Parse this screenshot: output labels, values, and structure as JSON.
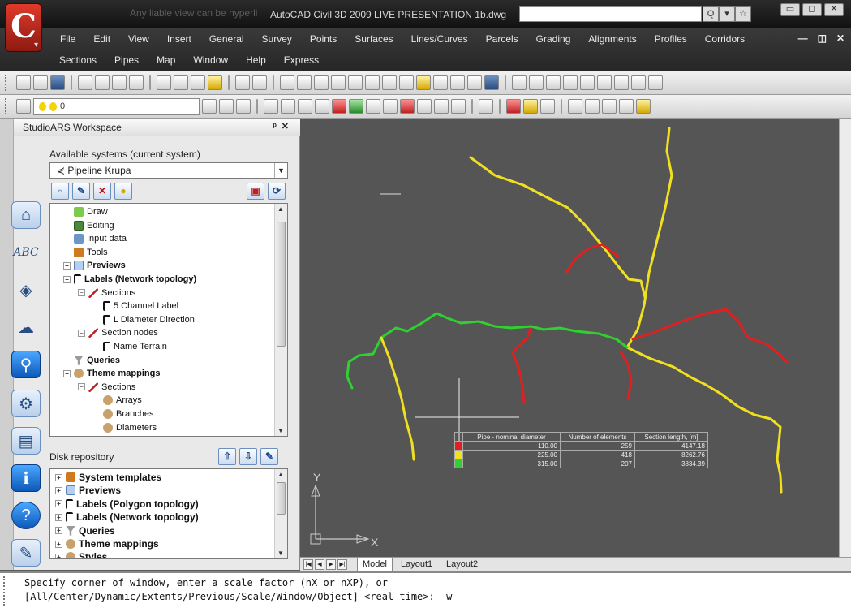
{
  "titlebar": {
    "faint_text": "Any liable view can be hyperli",
    "title": "AutoCAD Civil 3D 2009 LIVE PRESENTATION 1b.dwg"
  },
  "menu": {
    "row1": [
      "File",
      "Edit",
      "View",
      "Insert",
      "General",
      "Survey",
      "Points",
      "Surfaces",
      "Lines/Curves",
      "Parcels",
      "Grading",
      "Alignments",
      "Profiles",
      "Corridors"
    ],
    "row2": [
      "Sections",
      "Pipes",
      "Map",
      "Window",
      "Help",
      "Express"
    ]
  },
  "layer_combo": {
    "value": "0"
  },
  "workspace": {
    "title": "StudioARS Workspace",
    "available_label": "Available systems (current system)",
    "selected_system": "Pipeline Krupa",
    "tree": [
      {
        "label": "Draw",
        "icon": "draw-icon",
        "indent": 1,
        "bold": false
      },
      {
        "label": "Editing",
        "icon": "editing-icon",
        "indent": 1,
        "bold": false
      },
      {
        "label": "Input data",
        "icon": "input-data-icon",
        "indent": 1,
        "bold": false
      },
      {
        "label": "Tools",
        "icon": "tools-icon",
        "indent": 1,
        "bold": false
      },
      {
        "label": "Previews",
        "icon": "previews-icon",
        "indent": 1,
        "bold": true,
        "pm": "+"
      },
      {
        "label": "Labels (Network topology)",
        "icon": "label-flag-icon",
        "indent": 1,
        "bold": true,
        "pm": "−"
      },
      {
        "label": "Sections",
        "icon": "section-line-icon",
        "indent": 2,
        "bold": false,
        "pm": "−"
      },
      {
        "label": "5 Channel Label",
        "icon": "label-flag-icon",
        "indent": 3,
        "bold": false
      },
      {
        "label": "L Diameter Direction",
        "icon": "label-flag-icon",
        "indent": 3,
        "bold": false
      },
      {
        "label": "Section nodes",
        "icon": "section-nodes-icon",
        "indent": 2,
        "bold": false,
        "pm": "−"
      },
      {
        "label": "Name Terrain",
        "icon": "label-flag-icon",
        "indent": 3,
        "bold": false
      },
      {
        "label": "Queries",
        "icon": "funnel-icon",
        "indent": 1,
        "bold": true
      },
      {
        "label": "Theme mappings",
        "icon": "theme-icon",
        "indent": 1,
        "bold": true,
        "pm": "−"
      },
      {
        "label": "Sections",
        "icon": "section-line-icon",
        "indent": 2,
        "bold": false,
        "pm": "−"
      },
      {
        "label": "Arrays",
        "icon": "theme-icon",
        "indent": 3,
        "bold": false
      },
      {
        "label": "Branches",
        "icon": "theme-icon",
        "indent": 3,
        "bold": false
      },
      {
        "label": "Diameters",
        "icon": "theme-icon",
        "indent": 3,
        "bold": false
      }
    ],
    "repo_label": "Disk repository",
    "repo_tree": [
      {
        "label": "System templates",
        "icon": "templates-icon"
      },
      {
        "label": "Previews",
        "icon": "previews-icon"
      },
      {
        "label": "Labels (Polygon topology)",
        "icon": "label-flag-icon"
      },
      {
        "label": "Labels (Network topology)",
        "icon": "label-flag-icon"
      },
      {
        "label": "Queries",
        "icon": "funnel-icon"
      },
      {
        "label": "Theme mappings",
        "icon": "theme-icon"
      },
      {
        "label": "Styles",
        "icon": "theme-icon"
      }
    ]
  },
  "legend": {
    "headers": [
      "Pipe - nominal diameter",
      "Number of elements",
      "Section length, [m]"
    ],
    "rows": [
      {
        "color": "#e02020",
        "diameter": "110.00",
        "count": "259",
        "length": "4147.18"
      },
      {
        "color": "#f0e020",
        "diameter": "225.00",
        "count": "418",
        "length": "8262.76"
      },
      {
        "color": "#30d030",
        "diameter": "315.00",
        "count": "207",
        "length": "3834.39"
      }
    ]
  },
  "ucs": {
    "y": "Y",
    "x": "X"
  },
  "layout_tabs": [
    "Model",
    "Layout1",
    "Layout2"
  ],
  "command": {
    "line1": "Specify corner of window, enter a scale factor (nX or nXP), or",
    "line2": "[All/Center/Dynamic/Extents/Previous/Scale/Window/Object] <real time>: _w"
  },
  "colors": {
    "pipe_red": "#e02020",
    "pipe_yellow": "#f0e020",
    "pipe_green": "#30d030"
  }
}
